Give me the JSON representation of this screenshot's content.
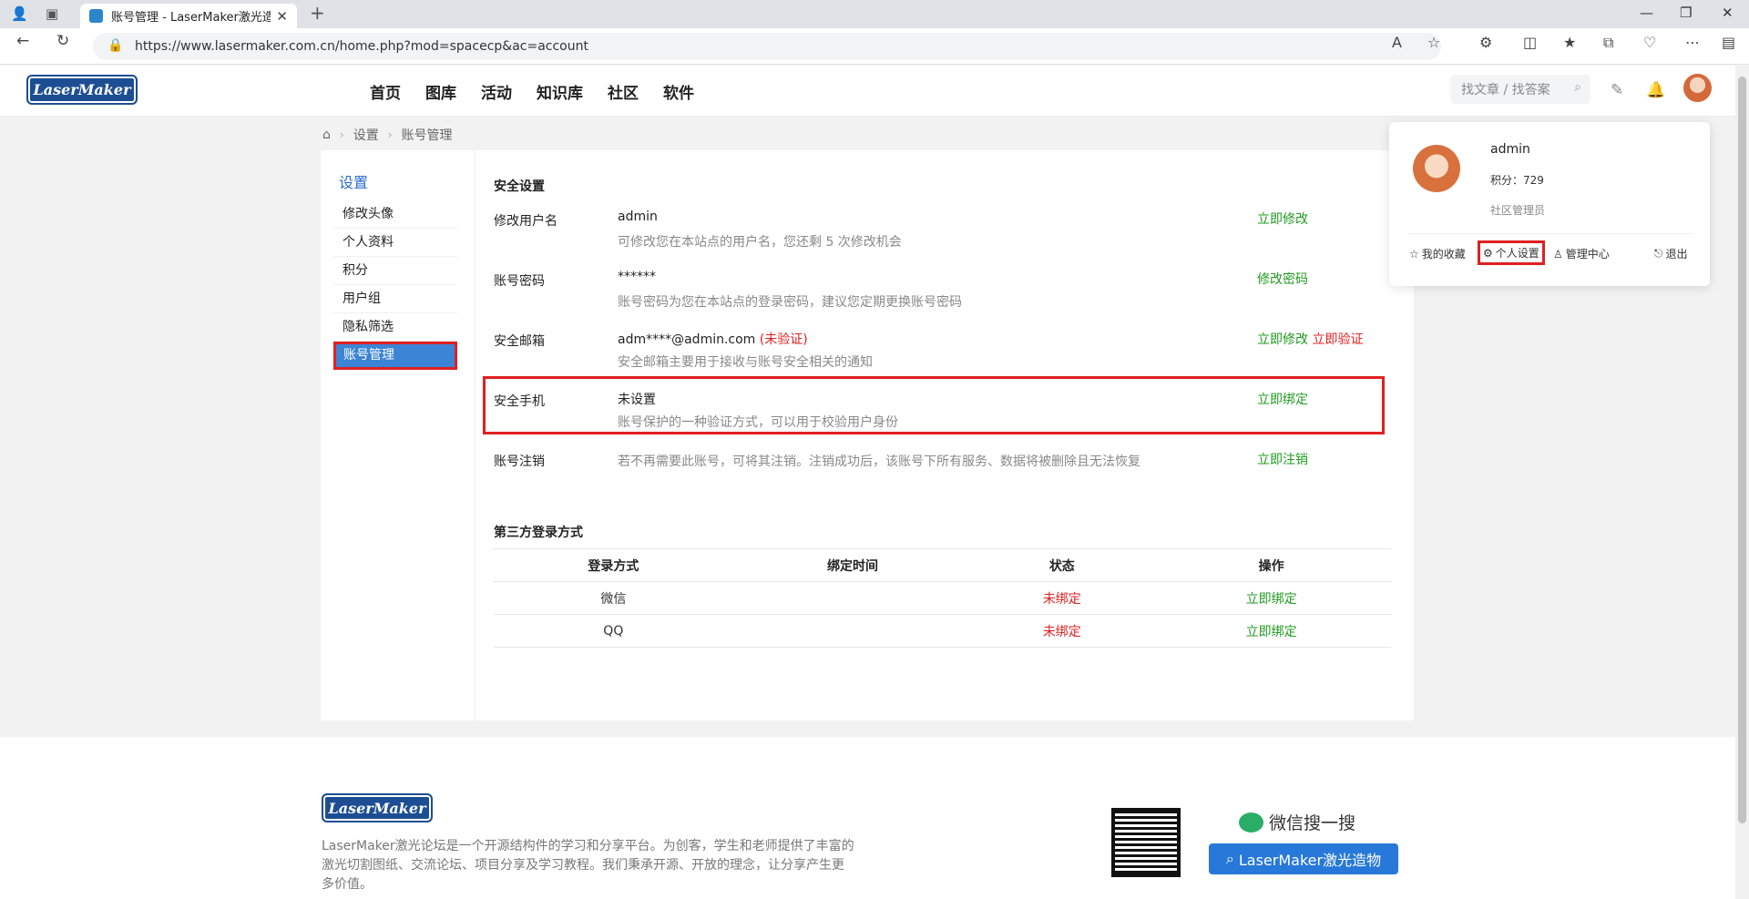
{
  "browser": {
    "tab_title": "账号管理 - LaserMaker激光造物",
    "url": "https://www.lasermaker.com.cn/home.php?mod=spacecp&ac=account"
  },
  "header": {
    "logo": "LaserMaker",
    "nav": [
      "首页",
      "图库",
      "活动",
      "知识库",
      "社区",
      "软件"
    ],
    "search_placeholder": "找文章 / 找答案"
  },
  "breadcrumb": [
    "设置",
    "账号管理"
  ],
  "sidebar": {
    "title": "设置",
    "items": [
      "修改头像",
      "个人资料",
      "积分",
      "用户组",
      "隐私筛选",
      "账号管理"
    ]
  },
  "security": {
    "section_title": "安全设置",
    "rows": [
      {
        "label": "修改用户名",
        "value": "admin",
        "desc": "可修改您在本站点的用户名，您还剩 5 次修改机会",
        "action": "立即修改"
      },
      {
        "label": "账号密码",
        "value": "******",
        "desc": "账号密码为您在本站点的登录密码，建议您定期更换账号密码",
        "action": "修改密码"
      },
      {
        "label": "安全邮箱",
        "value": "adm****@admin.com",
        "value_note": "(未验证)",
        "desc": "安全邮箱主要用于接收与账号安全相关的通知",
        "action": "立即修改",
        "action2": "立即验证"
      },
      {
        "label": "安全手机",
        "value": "未设置",
        "desc": "账号保护的一种验证方式，可以用于校验用户身份",
        "action": "立即绑定"
      },
      {
        "label": "账号注销",
        "value": "若不再需要此账号，可将其注销。注销成功后，该账号下所有服务、数据将被删除且无法恢复",
        "action": "立即注销"
      }
    ]
  },
  "third_party": {
    "section_title": "第三方登录方式",
    "headers": [
      "登录方式",
      "绑定时间",
      "状态",
      "操作"
    ],
    "rows": [
      {
        "method": "微信",
        "time": "",
        "status": "未绑定",
        "action": "立即绑定"
      },
      {
        "method": "QQ",
        "time": "",
        "status": "未绑定",
        "action": "立即绑定"
      }
    ]
  },
  "user_menu": {
    "name": "admin",
    "points": "积分：729",
    "role": "社区管理员",
    "links": [
      "我的收藏",
      "个人设置",
      "管理中心",
      "退出"
    ]
  },
  "footer": {
    "logo": "LaserMaker",
    "desc": "LaserMaker激光论坛是一个开源结构件的学习和分享平台。为创客，学生和老师提供了丰富的激光切割图纸、交流论坛、项目分享及学习教程。我们秉承开源、开放的理念，让分享产生更多价值。",
    "wechat_search": "微信搜一搜",
    "wechat_button": "LaserMaker激光造物"
  }
}
